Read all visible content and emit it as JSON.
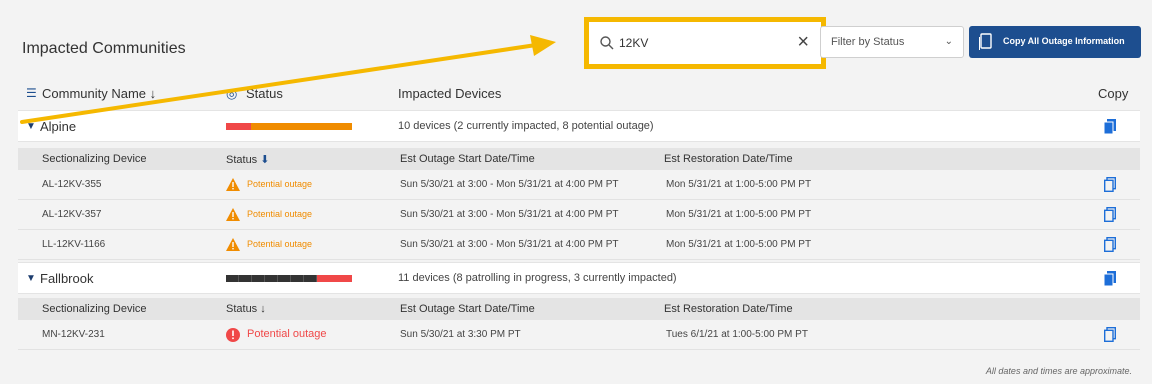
{
  "title": "Impacted Communities",
  "search": {
    "value": "12KV",
    "clear_icon": "close-icon"
  },
  "filter": {
    "label": "Filter by Status",
    "icon": "chevron-down-icon"
  },
  "copy_all": {
    "label": "Copy All Outage Information"
  },
  "columns": {
    "community": "Community Name",
    "status": "Status",
    "devices": "Impacted Devices",
    "copy": "Copy"
  },
  "sub_columns": {
    "device": "Sectionalizing Device",
    "status": "Status",
    "start": "Est Outage Start Date/Time",
    "restore": "Est Restoration Date/Time"
  },
  "colors": {
    "accent": "#1d4e8f",
    "highlight": "#f5b800",
    "orange": "#f08c00",
    "red": "#f04848",
    "dark": "#333333"
  },
  "groups": [
    {
      "name": "Alpine",
      "desc": "10 devices (2 currently impacted, 8 potential outage)",
      "bar": [
        {
          "frac": 0.2,
          "color": "#f04848"
        },
        {
          "frac": 0.8,
          "color": "#f08c00"
        }
      ],
      "rows": [
        {
          "device": "AL-12KV-355",
          "status": "Potential outage",
          "start": "Sun 5/30/21 at 3:00 - Mon 5/31/21 at 4:00 PM PT",
          "restore": "Mon 5/31/21 at 1:00-5:00 PM PT"
        },
        {
          "device": "AL-12KV-357",
          "status": "Potential outage",
          "start": "Sun 5/30/21 at 3:00 - Mon 5/31/21 at 4:00 PM PT",
          "restore": "Mon 5/31/21 at 1:00-5:00 PM PT"
        },
        {
          "device": "LL-12KV-1166",
          "status": "Potential outage",
          "start": "Sun 5/30/21 at 3:00 - Mon 5/31/21 at 4:00 PM PT",
          "restore": "Mon 5/31/21 at 1:00-5:00 PM PT"
        }
      ]
    },
    {
      "name": "Fallbrook",
      "desc": "11 devices (8 patrolling in progress, 3 currently impacted)",
      "bar": [
        {
          "frac": 0.72,
          "color": "#333333"
        },
        {
          "frac": 0.28,
          "color": "#f04848"
        }
      ],
      "rows": [
        {
          "device": "MN-12KV-231",
          "status": "Potential outage",
          "start": "Sun 5/30/21 at 3:30 PM PT",
          "restore": "Tues 6/1/21 at 1:00-5:00 PM PT"
        }
      ]
    }
  ],
  "footnote": "All dates and times are approximate."
}
